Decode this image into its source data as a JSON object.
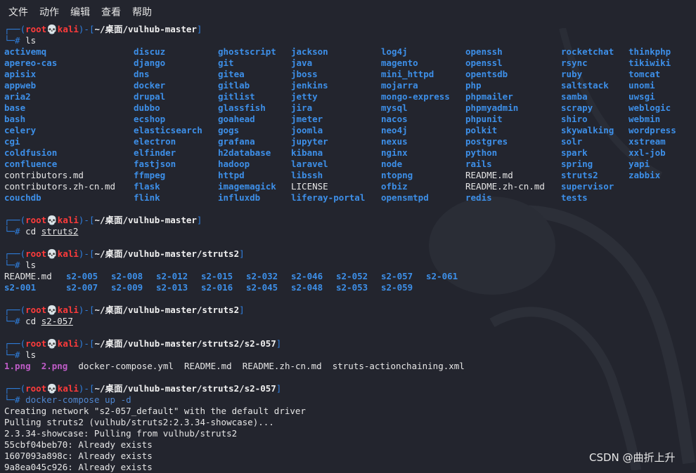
{
  "menu": [
    "文件",
    "动作",
    "编辑",
    "查看",
    "帮助"
  ],
  "prompt": {
    "user": "root",
    "skull": "💀",
    "host": "kali",
    "sep_open": "┌──(",
    "sep_mid": ")-[",
    "sep_close": "]",
    "hash": "└─# "
  },
  "ls_root": {
    "columns": [
      [
        "activemq",
        "apereo-cas",
        "apisix",
        "appweb",
        "aria2",
        "base",
        "bash",
        "celery",
        "cgi",
        "coldfusion",
        "confluence",
        "contributors.md",
        "contributors.zh-cn.md",
        "couchdb"
      ],
      [
        "discuz",
        "django",
        "dns",
        "docker",
        "drupal",
        "dubbo",
        "ecshop",
        "elasticsearch",
        "electron",
        "elfinder",
        "fastjson",
        "ffmpeg",
        "flask",
        "flink"
      ],
      [
        "ghostscript",
        "git",
        "gitea",
        "gitlab",
        "gitlist",
        "glassfish",
        "goahead",
        "gogs",
        "grafana",
        "h2database",
        "hadoop",
        "httpd",
        "imagemagick",
        "influxdb"
      ],
      [
        "jackson",
        "java",
        "jboss",
        "jenkins",
        "jetty",
        "jira",
        "jmeter",
        "joomla",
        "jupyter",
        "kibana",
        "laravel",
        "libssh",
        "LICENSE",
        "liferay-portal"
      ],
      [
        "log4j",
        "magento",
        "mini_httpd",
        "mojarra",
        "mongo-express",
        "mysql",
        "nacos",
        "neo4j",
        "nexus",
        "nginx",
        "node",
        "ntopng",
        "ofbiz",
        "opensmtpd"
      ],
      [
        "openssh",
        "openssl",
        "opentsdb",
        "php",
        "phpmailer",
        "phpmyadmin",
        "phpunit",
        "polkit",
        "postgres",
        "python",
        "rails",
        "README.md",
        "README.zh-cn.md",
        "redis"
      ],
      [
        "rocketchat",
        "rsync",
        "ruby",
        "saltstack",
        "samba",
        "scrapy",
        "shiro",
        "skywalking",
        "solr",
        "spark",
        "spring",
        "struts2",
        "supervisor",
        "tests"
      ],
      [
        "thinkphp",
        "tikiwiki",
        "tomcat",
        "unomi",
        "uwsgi",
        "weblogic",
        "webmin",
        "wordpress",
        "xstream",
        "xxl-job",
        "yapi",
        "zabbix"
      ]
    ]
  },
  "session": [
    {
      "path": "~/桌面/vulhub-master",
      "cmd": "ls",
      "arg": ""
    },
    {
      "path": "~/桌面/vulhub-master",
      "cmd": "cd",
      "arg": "struts2"
    },
    {
      "path": "~/桌面/vulhub-master/struts2",
      "cmd": "ls",
      "arg": ""
    },
    {
      "path": "~/桌面/vulhub-master/struts2",
      "cmd": "cd",
      "arg": "s2-057"
    },
    {
      "path": "~/桌面/vulhub-master/struts2/s2-057",
      "cmd": "ls",
      "arg": ""
    },
    {
      "path": "~/桌面/vulhub-master/struts2/s2-057",
      "cmd": "docker-compose",
      "arg": "up -d"
    }
  ],
  "ls_struts2": {
    "row1": [
      "README.md",
      "s2-005",
      "s2-008",
      "s2-012",
      "s2-015",
      "s2-032",
      "s2-046",
      "s2-052",
      "s2-057",
      "s2-061"
    ],
    "row2": [
      "s2-001",
      "s2-007",
      "s2-009",
      "s2-013",
      "s2-016",
      "s2-045",
      "s2-048",
      "s2-053",
      "s2-059"
    ]
  },
  "ls_s2057": [
    "1.png",
    "2.png",
    "docker-compose.yml",
    "README.md",
    "README.zh-cn.md",
    "struts-actionchaining.xml"
  ],
  "output": [
    "Creating network \"s2-057_default\" with the default driver",
    "Pulling struts2 (vulhub/struts2:2.3.34-showcase)...",
    "2.3.34-showcase: Pulling from vulhub/struts2",
    "55cbf04beb70: Already exists",
    "1607093a898c: Already exists",
    "9a8ea045c926: Already exists"
  ],
  "watermark": "CSDN @曲折上升"
}
